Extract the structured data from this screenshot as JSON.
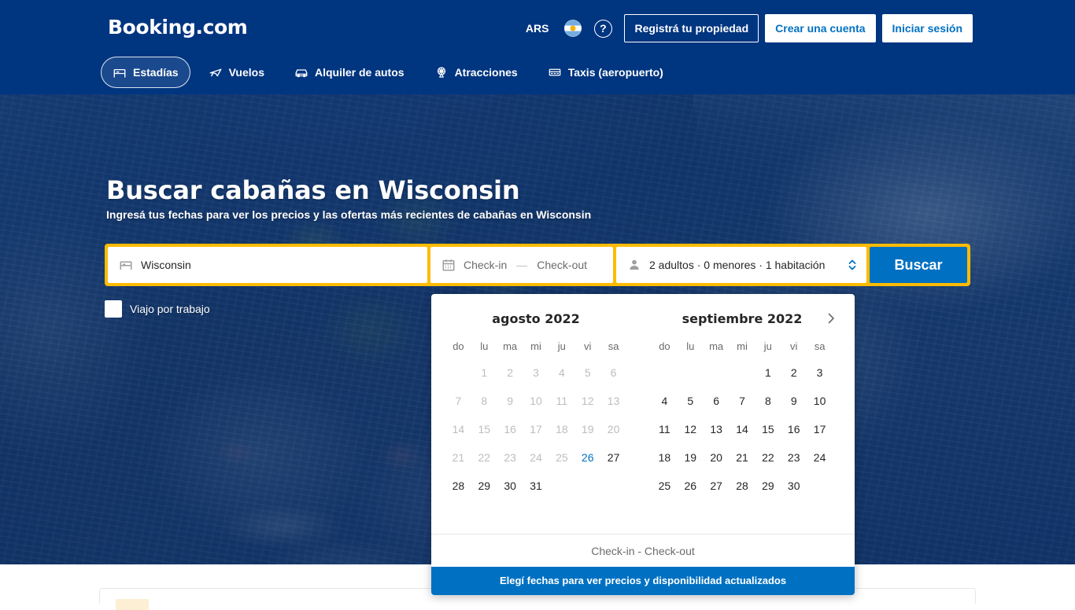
{
  "header": {
    "logo": "Booking.com",
    "currency": "ARS",
    "language_icon": "argentina-flag-icon",
    "help_icon": "help-circle-icon",
    "help_glyph": "?",
    "list_property_label": "Registrá tu propiedad",
    "register_label": "Crear una cuenta",
    "signin_label": "Iniciar sesión",
    "nav": [
      {
        "label": "Estadías",
        "icon": "bed-icon",
        "active": true
      },
      {
        "label": "Vuelos",
        "icon": "plane-icon",
        "active": false
      },
      {
        "label": "Alquiler de autos",
        "icon": "car-icon",
        "active": false
      },
      {
        "label": "Atracciones",
        "icon": "ferris-wheel-icon",
        "active": false
      },
      {
        "label": "Taxis (aeropuerto)",
        "icon": "taxi-icon",
        "active": false
      }
    ]
  },
  "hero": {
    "title": "Buscar cabañas en Wisconsin",
    "subtitle": "Ingresá tus fechas para ver los precios y las ofertas más recientes de cabañas en Wisconsin"
  },
  "search": {
    "destination_value": "Wisconsin",
    "destination_icon": "bed-icon",
    "dates_icon": "calendar-icon",
    "checkin_label": "Check-in",
    "checkout_label": "Check-out",
    "dates_separator": "—",
    "occupancy_icon": "person-icon",
    "occupancy_value": "2 adultos · 0 menores · 1 habitación",
    "stepper_icon": "chevron-updown-icon",
    "search_button": "Buscar",
    "business_travel_label": "Viajo por trabajo",
    "business_travel_checked": false,
    "accent_border_color": "#febb02",
    "button_color": "#0071c2"
  },
  "calendar": {
    "next_icon": "chevron-right-icon",
    "weekdays": [
      "do",
      "lu",
      "ma",
      "mi",
      "ju",
      "vi",
      "sa"
    ],
    "footer_text": "Check-in - Check-out",
    "banner_text": "Elegí fechas para ver precios y disponibilidad actualizados",
    "today_color": "#0071c2",
    "months": [
      {
        "title": "agosto 2022",
        "lead_blanks": 1,
        "days": [
          {
            "n": "1",
            "state": "past"
          },
          {
            "n": "2",
            "state": "past"
          },
          {
            "n": "3",
            "state": "past"
          },
          {
            "n": "4",
            "state": "past"
          },
          {
            "n": "5",
            "state": "past"
          },
          {
            "n": "6",
            "state": "past"
          },
          {
            "n": "7",
            "state": "past"
          },
          {
            "n": "8",
            "state": "past"
          },
          {
            "n": "9",
            "state": "past"
          },
          {
            "n": "10",
            "state": "past"
          },
          {
            "n": "11",
            "state": "past"
          },
          {
            "n": "12",
            "state": "past"
          },
          {
            "n": "13",
            "state": "past"
          },
          {
            "n": "14",
            "state": "past"
          },
          {
            "n": "15",
            "state": "past"
          },
          {
            "n": "16",
            "state": "past"
          },
          {
            "n": "17",
            "state": "past"
          },
          {
            "n": "18",
            "state": "past"
          },
          {
            "n": "19",
            "state": "past"
          },
          {
            "n": "20",
            "state": "past"
          },
          {
            "n": "21",
            "state": "past"
          },
          {
            "n": "22",
            "state": "past"
          },
          {
            "n": "23",
            "state": "past"
          },
          {
            "n": "24",
            "state": "past"
          },
          {
            "n": "25",
            "state": "past"
          },
          {
            "n": "26",
            "state": "today"
          },
          {
            "n": "27",
            "state": "sel"
          },
          {
            "n": "28",
            "state": "sel"
          },
          {
            "n": "29",
            "state": "sel"
          },
          {
            "n": "30",
            "state": "sel"
          },
          {
            "n": "31",
            "state": "sel"
          }
        ]
      },
      {
        "title": "septiembre 2022",
        "lead_blanks": 4,
        "days": [
          {
            "n": "1",
            "state": "sel"
          },
          {
            "n": "2",
            "state": "sel"
          },
          {
            "n": "3",
            "state": "sel"
          },
          {
            "n": "4",
            "state": "sel"
          },
          {
            "n": "5",
            "state": "sel"
          },
          {
            "n": "6",
            "state": "sel"
          },
          {
            "n": "7",
            "state": "sel"
          },
          {
            "n": "8",
            "state": "sel"
          },
          {
            "n": "9",
            "state": "sel"
          },
          {
            "n": "10",
            "state": "sel"
          },
          {
            "n": "11",
            "state": "sel"
          },
          {
            "n": "12",
            "state": "sel"
          },
          {
            "n": "13",
            "state": "sel"
          },
          {
            "n": "14",
            "state": "sel"
          },
          {
            "n": "15",
            "state": "sel"
          },
          {
            "n": "16",
            "state": "sel"
          },
          {
            "n": "17",
            "state": "sel"
          },
          {
            "n": "18",
            "state": "sel"
          },
          {
            "n": "19",
            "state": "sel"
          },
          {
            "n": "20",
            "state": "sel"
          },
          {
            "n": "21",
            "state": "sel"
          },
          {
            "n": "22",
            "state": "sel"
          },
          {
            "n": "23",
            "state": "sel"
          },
          {
            "n": "24",
            "state": "sel"
          },
          {
            "n": "25",
            "state": "sel"
          },
          {
            "n": "26",
            "state": "sel"
          },
          {
            "n": "27",
            "state": "sel"
          },
          {
            "n": "28",
            "state": "sel"
          },
          {
            "n": "29",
            "state": "sel"
          },
          {
            "n": "30",
            "state": "sel"
          }
        ]
      }
    ]
  }
}
